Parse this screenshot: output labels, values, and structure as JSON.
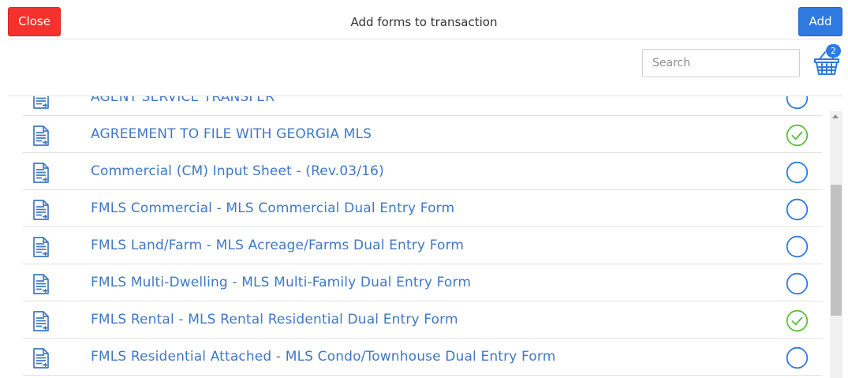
{
  "header": {
    "close_label": "Close",
    "title": "Add forms to transaction",
    "add_label": "Add"
  },
  "search": {
    "placeholder": "Search",
    "value": ""
  },
  "cart": {
    "icon": "basket-icon",
    "count": "2"
  },
  "colors": {
    "close": "#f4312c",
    "add": "#2f7ae0",
    "link": "#3f78c6",
    "checked": "#5bbf3a",
    "unchecked": "#2f7ae0"
  },
  "forms": [
    {
      "name": "AGENT SERVICE TRANSFER",
      "selected": false
    },
    {
      "name": "AGREEMENT TO FILE WITH GEORGIA MLS",
      "selected": true
    },
    {
      "name": "Commercial (CM) Input Sheet - (Rev.03/16)",
      "selected": false
    },
    {
      "name": "FMLS Commercial - MLS Commercial Dual Entry Form",
      "selected": false
    },
    {
      "name": "FMLS Land/Farm - MLS Acreage/Farms Dual Entry Form",
      "selected": false
    },
    {
      "name": "FMLS Multi-Dwelling - MLS Multi-Family Dual Entry Form",
      "selected": false
    },
    {
      "name": "FMLS Rental - MLS Rental Residential Dual Entry Form",
      "selected": true
    },
    {
      "name": "FMLS Residential Attached - MLS Condo/Townhouse Dual Entry Form",
      "selected": false
    }
  ]
}
